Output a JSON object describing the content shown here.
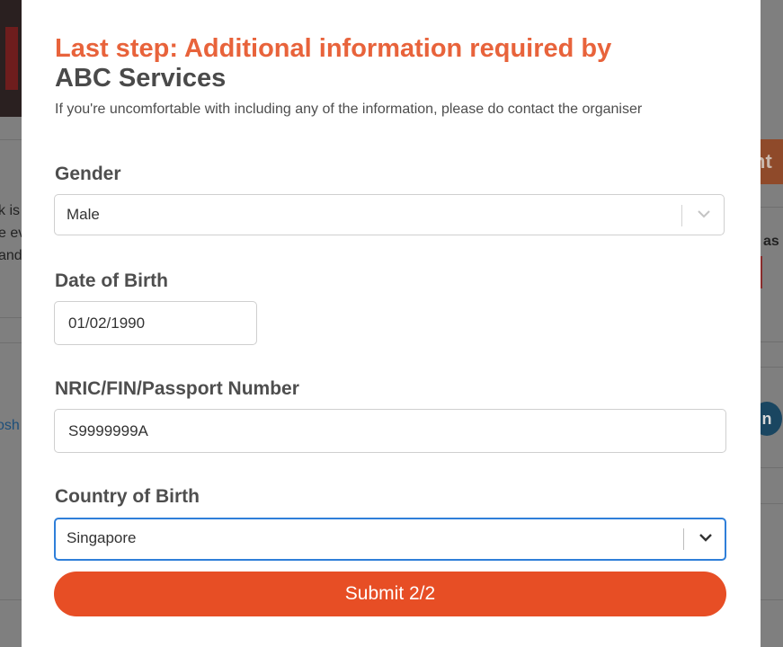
{
  "background": {
    "left_text_lines": [
      "k is",
      "e ev",
      "and"
    ],
    "right_button_fragment": "nt f",
    "right_text_fragment": "as",
    "left_link_fragment": "osh",
    "circle_icon_letter": "n"
  },
  "modal": {
    "title_accent": "Last step: Additional information required by",
    "title_org": "ABC Services",
    "subtitle": "If you're uncomfortable with including any of the information, please do contact the organiser",
    "fields": {
      "gender": {
        "label": "Gender",
        "value": "Male"
      },
      "dob": {
        "label": "Date of Birth",
        "value": "01/02/1990"
      },
      "id_number": {
        "label": "NRIC/FIN/Passport Number",
        "value": "S9999999A"
      },
      "country_of_birth": {
        "label": "Country of Birth",
        "value": "Singapore"
      }
    },
    "submit_label": "Submit 2/2"
  },
  "colors": {
    "accent": "#e8633b",
    "submit": "#e74e25",
    "focus": "#2f7fd9"
  }
}
